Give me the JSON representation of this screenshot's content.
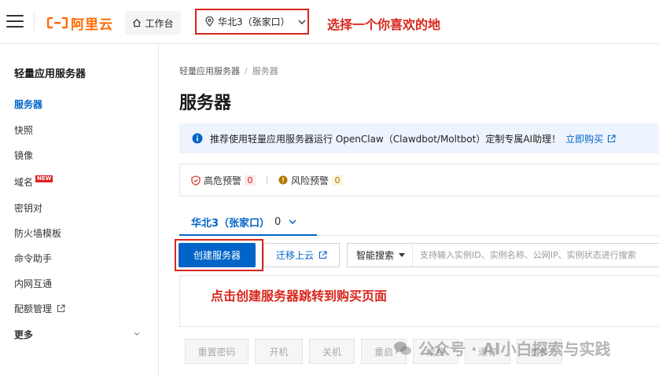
{
  "header": {
    "logo_text": "阿里云",
    "workbench_label": "工作台",
    "region_label": "华北3（张家口）",
    "annotation": "选择一个你喜欢的地"
  },
  "sidebar": {
    "title": "轻量应用服务器",
    "items": [
      {
        "label": "服务器",
        "active": true
      },
      {
        "label": "快照"
      },
      {
        "label": "镜像"
      },
      {
        "label": "域名",
        "badge": "NEW"
      },
      {
        "label": "密钥对"
      },
      {
        "label": "防火墙模板"
      },
      {
        "label": "命令助手"
      },
      {
        "label": "内网互通"
      },
      {
        "label": "配额管理"
      },
      {
        "label": "更多"
      }
    ]
  },
  "main": {
    "breadcrumb": [
      "轻量应用服务器",
      "服务器"
    ],
    "breadcrumb_sep": "/",
    "title": "服务器",
    "notice": {
      "text": "推荐使用轻量应用服务器运行 OpenClaw（Clawdbot/Moltbot）定制专属AI助理！",
      "link": "立即购买"
    },
    "alerts": {
      "high_label": "高危预警",
      "high_count": "0",
      "risk_label": "风险预警",
      "risk_count": "0"
    },
    "tab": {
      "label": "华北3（张家口）",
      "count": "0"
    },
    "toolbar": {
      "create_label": "创建服务器",
      "migrate_label": "迁移上云",
      "search_type": "智能搜索",
      "search_placeholder": "支持输入实例ID、实例名称、公网IP、实例状态进行搜索"
    },
    "annotation": "点击创建服务器跳转到购买页面",
    "actions": [
      "重置密码",
      "开机",
      "关机",
      "重启",
      "续费",
      "退订",
      "更多"
    ]
  },
  "watermark": "公众号 · AI小白探索与实践",
  "colors": {
    "brand": "#ff6a00",
    "primary": "#0064c8",
    "annotation": "#d8261c"
  }
}
